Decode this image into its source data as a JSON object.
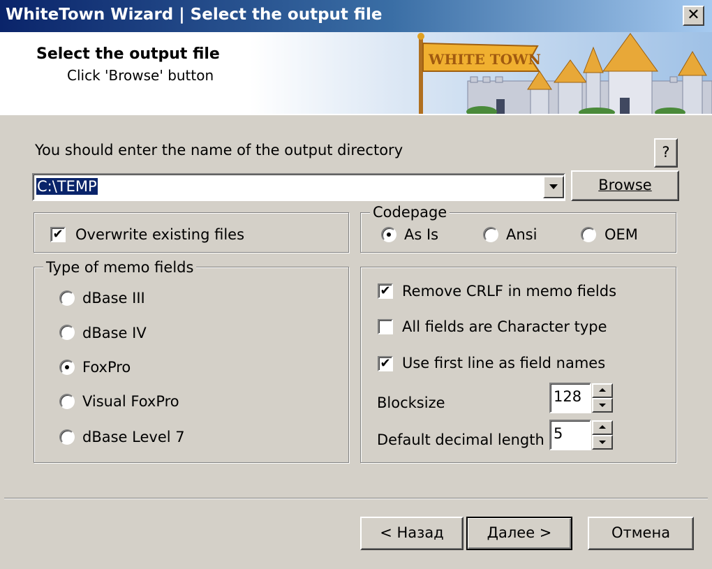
{
  "window": {
    "title": "WhiteTown Wizard | Select the output file",
    "close_glyph": "✕"
  },
  "header": {
    "title": "Select the output file",
    "subtitle": "Click 'Browse' button",
    "logo_text": "WHITE TOWN"
  },
  "output": {
    "prompt": "You should enter the name of the output directory",
    "help_label": "?",
    "path_value": "C:\\TEMP",
    "browse_label": "Browse"
  },
  "overwrite": {
    "label": "Overwrite existing files",
    "checked": true
  },
  "codepage": {
    "legend": "Codepage",
    "options": [
      {
        "label": "As Is",
        "checked": true
      },
      {
        "label": "Ansi",
        "checked": false
      },
      {
        "label": "OEM",
        "checked": false
      }
    ]
  },
  "memo": {
    "legend": "Type of memo fields",
    "options": [
      {
        "label": "dBase III",
        "checked": false
      },
      {
        "label": "dBase IV",
        "checked": false
      },
      {
        "label": "FoxPro",
        "checked": true
      },
      {
        "label": "Visual FoxPro",
        "checked": false
      },
      {
        "label": "dBase Level 7",
        "checked": false
      }
    ]
  },
  "options": {
    "checks": [
      {
        "label": "Remove CRLF in memo fields",
        "checked": true
      },
      {
        "label": "All fields are Character type",
        "checked": false
      },
      {
        "label": "Use first line as field names",
        "checked": true
      }
    ],
    "blocksize": {
      "label": "Blocksize",
      "value": "128"
    },
    "decimal": {
      "label": "Default decimal length",
      "value": "5"
    }
  },
  "footer": {
    "back_label": "< Назад",
    "next_label": "Далее >",
    "cancel_label": "Отмена"
  },
  "colors": {
    "titlebar_start": "#0a246a",
    "titlebar_end": "#a6caf0",
    "face": "#d4d0c8",
    "selection": "#0a246a"
  },
  "icons": {
    "check": "check-mark-icon",
    "combo_arrow": "chevron-down-icon",
    "spin_up": "spin-up-icon",
    "spin_down": "spin-down-icon"
  }
}
